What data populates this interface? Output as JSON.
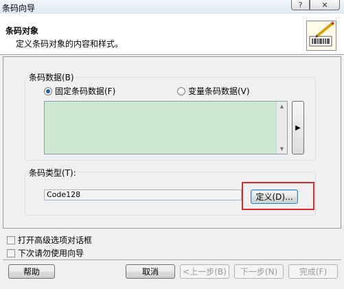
{
  "window": {
    "title": "条码向导",
    "help_glyph": "?",
    "close_glyph": "✕"
  },
  "header": {
    "title": "条码对象",
    "subtitle": "定义条码对象的内容和样式。",
    "icon": "barcode-pen-icon"
  },
  "barcode_data": {
    "group_label": "条码数据(B)",
    "options": [
      {
        "label": "固定条码数据(F)",
        "checked": true
      },
      {
        "label": "变量条码数据(V)",
        "checked": false
      }
    ],
    "value": "",
    "expand_glyph": "▶"
  },
  "barcode_type": {
    "group_label": "条码类型(T):",
    "value": "Code128",
    "define_button": "定义(D)..."
  },
  "options": {
    "advanced_dialog": {
      "label": "打开高级选项对话框",
      "checked": false
    },
    "skip_wizard": {
      "label": "下次请勿使用向导",
      "checked": false
    }
  },
  "footer": {
    "help": "帮助",
    "cancel": "取消",
    "back": "<上一步(B)",
    "next": "下一步(N)",
    "finish": "完成(F)"
  },
  "colors": {
    "highlight": "#e02a2a",
    "data_area_bg": "#cce8cf"
  }
}
